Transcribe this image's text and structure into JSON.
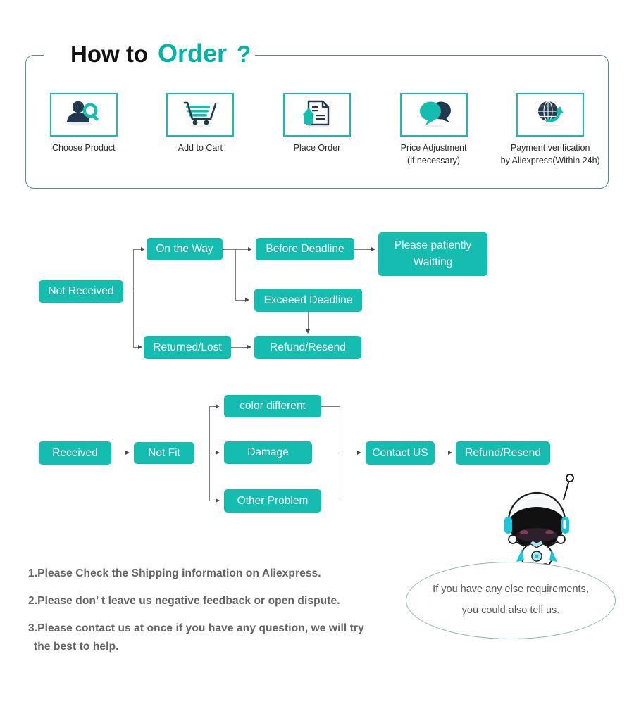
{
  "header": {
    "title_part1": "How to",
    "title_part2": "Order",
    "title_part3": "?",
    "accent_color": "#00b3a4",
    "frame_color": "#4e8f8c"
  },
  "steps": [
    {
      "icon": "person-search-icon",
      "label": "Choose  Product",
      "sub": ""
    },
    {
      "icon": "shopping-cart-icon",
      "label": "Add to Cart",
      "sub": ""
    },
    {
      "icon": "document-upload-icon",
      "label": "Place  Order",
      "sub": ""
    },
    {
      "icon": "speech-bubbles-icon",
      "label": "Price Adjustment",
      "sub": "(if necessary)"
    },
    {
      "icon": "globe-arrow-icon",
      "label": "Payment verification",
      "sub": "by Aliexpress(Within 24h)"
    }
  ],
  "flow_not_received": {
    "box_color": "#14bdaf",
    "nodes": {
      "not_received": "Not Received",
      "on_the_way": "On the Way",
      "before_deadline": "Before Deadline",
      "please_waiting_l1": "Please patiently",
      "please_waiting_l2": "Waitting",
      "exceed_deadline": "Exceeed Deadline",
      "returned_lost": "Returned/Lost",
      "refund_resend": "Refund/Resend"
    }
  },
  "flow_received": {
    "box_color": "#14bdaf",
    "nodes": {
      "received": "Received",
      "not_fit": "Not Fit",
      "color_different": "color different",
      "damage": "Damage",
      "other_problem": "Other Problem",
      "contact_us": "Contact US",
      "refund_resend": "Refund/Resend"
    }
  },
  "notes": [
    "1.Please Check the Shipping information on Aliexpress.",
    "2.Please don’ t leave us negative feedback or open dispute.",
    "3.Please contact us at once if you have any question, we will try",
    " the best to help."
  ],
  "bubble": {
    "line1": "If you have any else requirements,",
    "line2": "you could also tell us.",
    "border_color": "#8fb9b4"
  },
  "mascot": {
    "name": "astronaut-mascot"
  }
}
